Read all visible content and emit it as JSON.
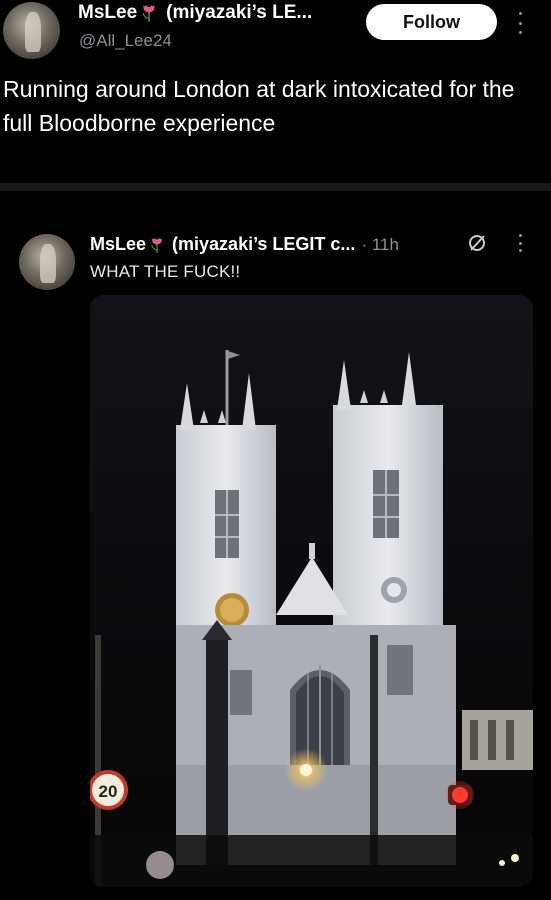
{
  "post": {
    "display_name": "MsLee",
    "name_suffix": "(miyazaki’s LE...",
    "handle": "@All_Lee24",
    "follow_label": "Follow",
    "text": "Running around London at dark intoxicated for the full Bloodborne experience"
  },
  "quoted": {
    "display_name": "MsLee",
    "name_suffix": "(miyazaki’s LEGIT c...",
    "time": "· 11h",
    "text": "WHAT THE FUCK!!",
    "photo": {
      "sign_text": "20"
    }
  },
  "icons": {
    "tulip": "tulip-emoji-icon",
    "more": "more-vertical-icon",
    "grok": "grok-icon"
  },
  "colors": {
    "background": "#000000",
    "secondary_text": "#8b9096",
    "follow_bg": "#ffffff"
  }
}
